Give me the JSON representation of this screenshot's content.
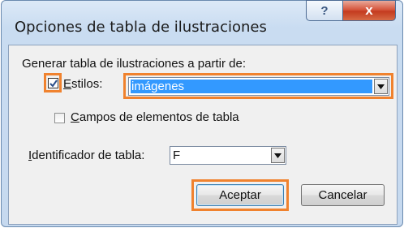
{
  "window": {
    "title": "Opciones de tabla de ilustraciones"
  },
  "title_buttons": {
    "help_symbol": "?",
    "close_symbol": "x"
  },
  "section": {
    "label": "Generar tabla de ilustraciones a partir de:"
  },
  "estilos": {
    "label_first": "E",
    "label_rest": "stilos:",
    "checked": true,
    "value": "imágenes"
  },
  "campos": {
    "label_first": "C",
    "label_rest": "ampos de elementos de tabla",
    "checked": false
  },
  "identificador": {
    "label_first": "I",
    "label_rest": "dentificador de tabla:",
    "value": "F"
  },
  "buttons": {
    "ok": "Aceptar",
    "cancel": "Cancelar"
  },
  "colors": {
    "highlight": "#f0822e",
    "selection": "#3399ff",
    "accent_border": "#3c7fb1"
  }
}
